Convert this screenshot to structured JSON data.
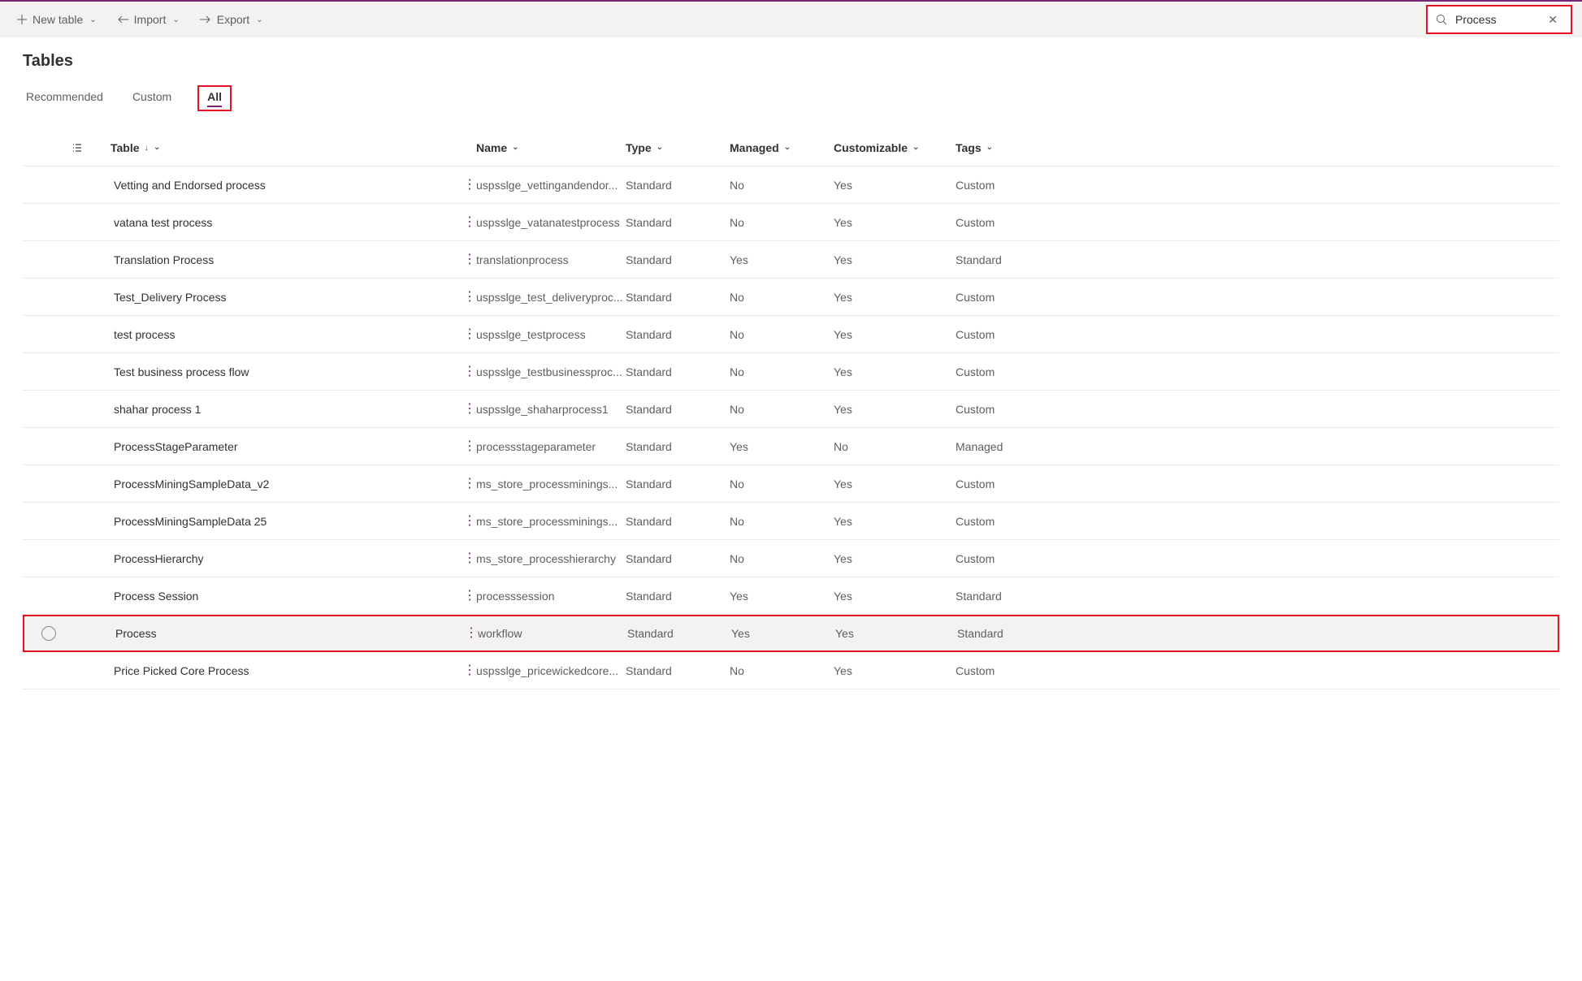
{
  "toolbar": {
    "new_table": "New table",
    "import": "Import",
    "export": "Export"
  },
  "search": {
    "value": "Process"
  },
  "page_title": "Tables",
  "tabs": [
    {
      "label": "Recommended",
      "active": false
    },
    {
      "label": "Custom",
      "active": false
    },
    {
      "label": "All",
      "active": true,
      "highlight": true
    }
  ],
  "columns": {
    "table": "Table",
    "name": "Name",
    "type": "Type",
    "managed": "Managed",
    "customizable": "Customizable",
    "tags": "Tags"
  },
  "rows": [
    {
      "table": "Vetting and Endorsed process",
      "name": "uspsslge_vettingandendor...",
      "type": "Standard",
      "managed": "No",
      "customizable": "Yes",
      "tags": "Custom"
    },
    {
      "table": "vatana test process",
      "name": "uspsslge_vatanatestprocess",
      "type": "Standard",
      "managed": "No",
      "customizable": "Yes",
      "tags": "Custom"
    },
    {
      "table": "Translation Process",
      "name": "translationprocess",
      "type": "Standard",
      "managed": "Yes",
      "customizable": "Yes",
      "tags": "Standard"
    },
    {
      "table": "Test_Delivery Process",
      "name": "uspsslge_test_deliveryproc...",
      "type": "Standard",
      "managed": "No",
      "customizable": "Yes",
      "tags": "Custom"
    },
    {
      "table": "test process",
      "name": "uspsslge_testprocess",
      "type": "Standard",
      "managed": "No",
      "customizable": "Yes",
      "tags": "Custom"
    },
    {
      "table": "Test business process flow",
      "name": "uspsslge_testbusinessproc...",
      "type": "Standard",
      "managed": "No",
      "customizable": "Yes",
      "tags": "Custom"
    },
    {
      "table": "shahar process 1",
      "name": "uspsslge_shaharprocess1",
      "type": "Standard",
      "managed": "No",
      "customizable": "Yes",
      "tags": "Custom"
    },
    {
      "table": "ProcessStageParameter",
      "name": "processstageparameter",
      "type": "Standard",
      "managed": "Yes",
      "customizable": "No",
      "tags": "Managed"
    },
    {
      "table": "ProcessMiningSampleData_v2",
      "name": "ms_store_processminings...",
      "type": "Standard",
      "managed": "No",
      "customizable": "Yes",
      "tags": "Custom"
    },
    {
      "table": "ProcessMiningSampleData 25",
      "name": "ms_store_processminings...",
      "type": "Standard",
      "managed": "No",
      "customizable": "Yes",
      "tags": "Custom"
    },
    {
      "table": "ProcessHierarchy",
      "name": "ms_store_processhierarchy",
      "type": "Standard",
      "managed": "No",
      "customizable": "Yes",
      "tags": "Custom"
    },
    {
      "table": "Process Session",
      "name": "processsession",
      "type": "Standard",
      "managed": "Yes",
      "customizable": "Yes",
      "tags": "Standard"
    },
    {
      "table": "Process",
      "name": "workflow",
      "type": "Standard",
      "managed": "Yes",
      "customizable": "Yes",
      "tags": "Standard",
      "selected": true,
      "highlight": true
    },
    {
      "table": "Price Picked Core Process",
      "name": "uspsslge_pricewickedcore...",
      "type": "Standard",
      "managed": "No",
      "customizable": "Yes",
      "tags": "Custom"
    }
  ]
}
